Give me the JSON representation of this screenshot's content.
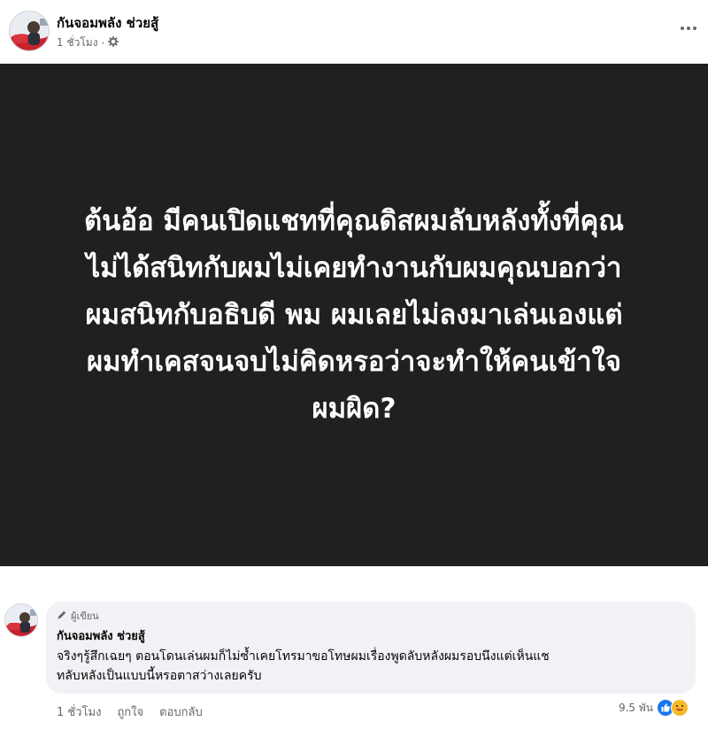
{
  "post": {
    "author": "กันจอมพลัง ช่วยสู้",
    "time": "1 ชั่วโมง",
    "separator": "·",
    "privacy_icon": "gear-icon",
    "more_icon": "more-dots-icon",
    "image_text": [
      "ต้นอ้อ มีคนเปิดแชทที่คุณดิสผมลับหลังทั้งที่คุณ",
      "ไม่ได้สนิทกับผมไม่เคยทำงานกับผมคุณบอกว่า",
      "ผมสนิทกับอธิบดี พม ผมเลยไม่ลงมาเล่นเองแต่",
      "ผมทำเคสจนจบไม่คิดหรอว่าจะทำให้คนเข้าใจ",
      "ผมผิด?"
    ],
    "image_background": "#202020"
  },
  "comment": {
    "badge": "ผู้เขียน",
    "badge_icon": "pencil-icon",
    "author": "กันจอมพลัง ช่วยสู้",
    "text_lines": [
      "จริงๆรู้สึกเฉยๆ ตอนโดนเล่นผมก็ไม่ซ้ำเคยโทรมาขอโทษผมเรื่องพูดลับหลังผมรอบนึงแต่เห็นแช",
      "ทลับหลังเป็นแบบนี้หรอตาสว่างเลยครับ"
    ],
    "time": "1 ชั่วโมง",
    "like_label": "ถูกใจ",
    "reply_label": "ตอบกลับ",
    "reaction_count": "9.5 พัน",
    "reaction_icons": [
      "like-icon",
      "care-icon"
    ]
  },
  "colors": {
    "secondary_text": "#65676b",
    "bubble": "#f0f2f5",
    "like_blue": "#1877f2",
    "care_yellow": "#f7b928"
  }
}
